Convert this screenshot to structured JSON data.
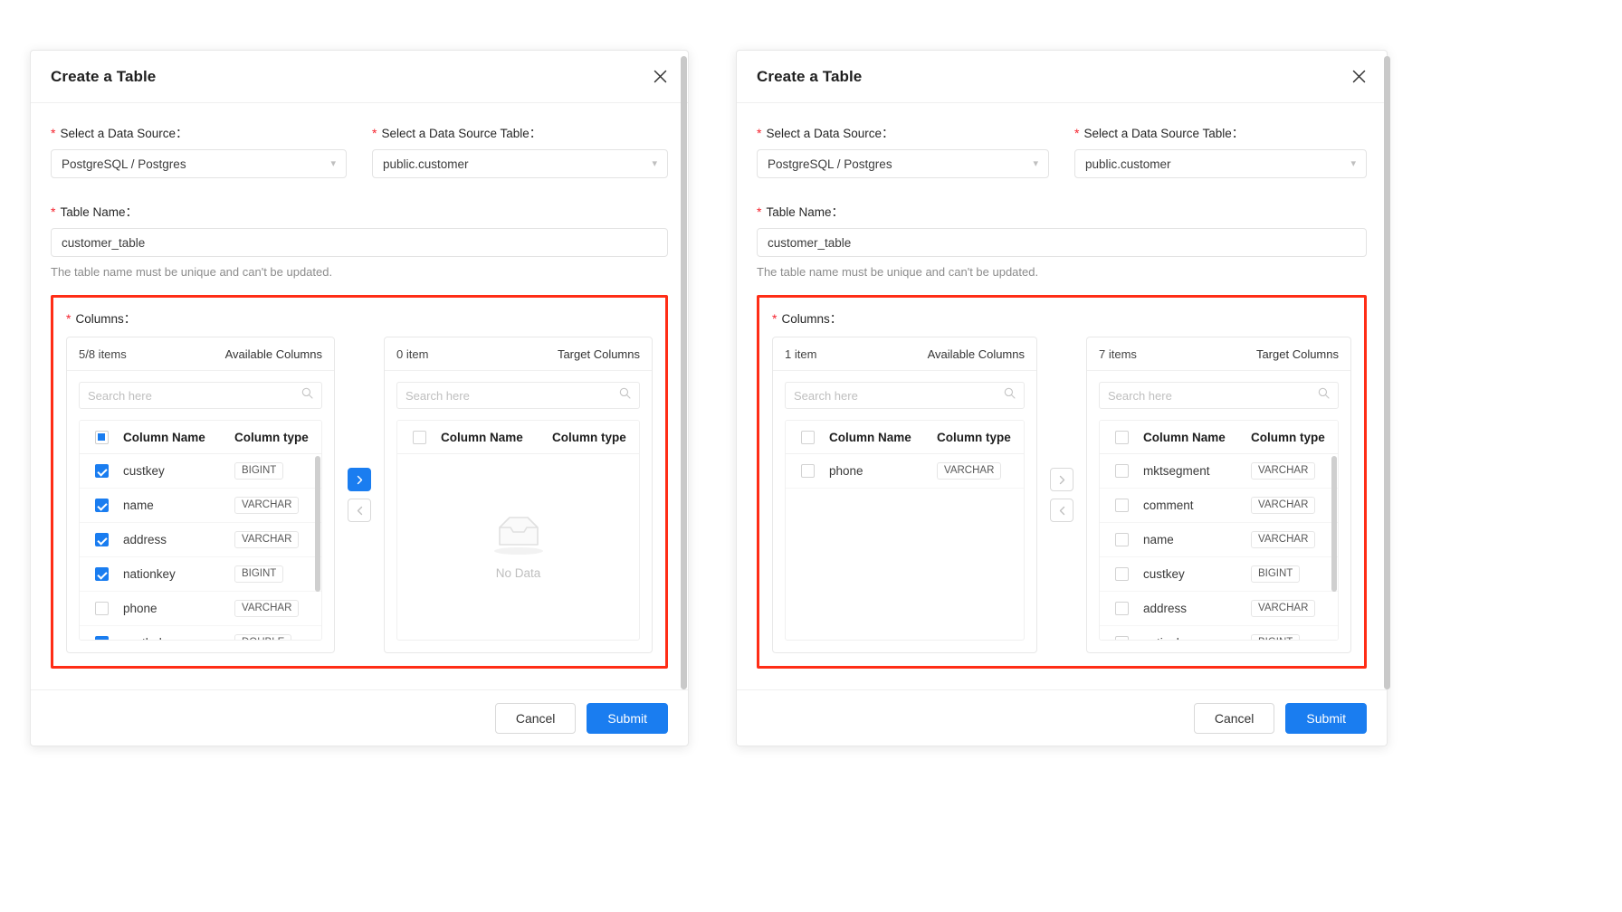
{
  "colors": {
    "primary": "#1a7df0",
    "required_star": "#f5222d",
    "annotation_box": "#ff2d16",
    "muted_text": "#8c8c8c"
  },
  "dialogs": [
    {
      "id": "left",
      "title": "Create a Table",
      "close_icon": "close-icon",
      "form": {
        "data_source": {
          "label": "Select a Data Source：",
          "value": "PostgreSQL / Postgres",
          "caret_icon": "chevron-down-icon"
        },
        "data_source_table": {
          "label": "Select a Data Source Table：",
          "value": "public.customer",
          "caret_icon": "chevron-down-icon"
        },
        "table_name": {
          "label": "Table Name：",
          "value": "customer_table",
          "placeholder": "",
          "hint": "The table name must be unique and can't be updated."
        },
        "columns_label": "Columns："
      },
      "transfer": {
        "available": {
          "count_text": "5/8 items",
          "panel_title": "Available Columns",
          "search_placeholder": "Search here",
          "search_value": "",
          "header_checkbox_state": "indeterminate",
          "headers": {
            "name": "Column Name",
            "type": "Column type"
          },
          "rows": [
            {
              "checked": true,
              "name": "custkey",
              "type": "BIGINT"
            },
            {
              "checked": true,
              "name": "name",
              "type": "VARCHAR"
            },
            {
              "checked": true,
              "name": "address",
              "type": "VARCHAR"
            },
            {
              "checked": true,
              "name": "nationkey",
              "type": "BIGINT"
            },
            {
              "checked": false,
              "name": "phone",
              "type": "VARCHAR"
            },
            {
              "checked": true,
              "name": "acctbal",
              "type": "DOUBLE"
            }
          ],
          "has_scrollbar": true
        },
        "target": {
          "count_text": "0 item",
          "panel_title": "Target Columns",
          "search_placeholder": "Search here",
          "search_value": "",
          "header_checkbox_state": "unchecked",
          "headers": {
            "name": "Column Name",
            "type": "Column type"
          },
          "rows": [],
          "empty_text": "No Data",
          "empty_icon": "inbox-empty-icon",
          "has_scrollbar": false
        },
        "move_right_icon": "chevron-right-icon",
        "move_left_icon": "chevron-left-icon",
        "move_right_enabled": true,
        "move_left_enabled": false
      },
      "footer": {
        "cancel": "Cancel",
        "submit": "Submit"
      }
    },
    {
      "id": "right",
      "title": "Create a Table",
      "close_icon": "close-icon",
      "form": {
        "data_source": {
          "label": "Select a Data Source：",
          "value": "PostgreSQL / Postgres",
          "caret_icon": "chevron-down-icon"
        },
        "data_source_table": {
          "label": "Select a Data Source Table：",
          "value": "public.customer",
          "caret_icon": "chevron-down-icon"
        },
        "table_name": {
          "label": "Table Name：",
          "value": "customer_table",
          "placeholder": "",
          "hint": "The table name must be unique and can't be updated."
        },
        "columns_label": "Columns："
      },
      "transfer": {
        "available": {
          "count_text": "1 item",
          "panel_title": "Available Columns",
          "search_placeholder": "Search here",
          "search_value": "",
          "header_checkbox_state": "unchecked",
          "headers": {
            "name": "Column Name",
            "type": "Column type"
          },
          "rows": [
            {
              "checked": false,
              "name": "phone",
              "type": "VARCHAR"
            }
          ],
          "has_scrollbar": false
        },
        "target": {
          "count_text": "7 items",
          "panel_title": "Target Columns",
          "search_placeholder": "Search here",
          "search_value": "",
          "header_checkbox_state": "unchecked",
          "headers": {
            "name": "Column Name",
            "type": "Column type"
          },
          "rows": [
            {
              "checked": false,
              "name": "mktsegment",
              "type": "VARCHAR"
            },
            {
              "checked": false,
              "name": "comment",
              "type": "VARCHAR"
            },
            {
              "checked": false,
              "name": "name",
              "type": "VARCHAR"
            },
            {
              "checked": false,
              "name": "custkey",
              "type": "BIGINT"
            },
            {
              "checked": false,
              "name": "address",
              "type": "VARCHAR"
            },
            {
              "checked": false,
              "name": "nationkey",
              "type": "BIGINT"
            }
          ],
          "has_scrollbar": true
        },
        "move_right_icon": "chevron-right-icon",
        "move_left_icon": "chevron-left-icon",
        "move_right_enabled": false,
        "move_left_enabled": false
      },
      "footer": {
        "cancel": "Cancel",
        "submit": "Submit"
      }
    }
  ]
}
